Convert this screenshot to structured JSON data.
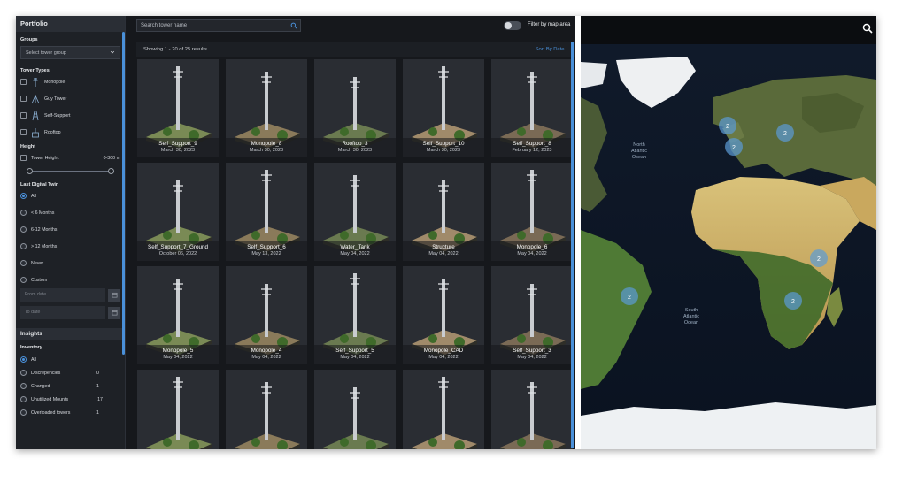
{
  "sidebar": {
    "title": "Portfolio",
    "groups_label": "Groups",
    "groups_select": "Select tower group",
    "tower_types_label": "Tower Types",
    "tower_types": [
      "Monopole",
      "Guy Tower",
      "Self-Support",
      "Rooftop"
    ],
    "height_label": "Height",
    "tower_height_label": "Tower Height:",
    "tower_height_value": "0-300 m",
    "last_twin_label": "Last Digital Twin",
    "last_twin_options": [
      "All",
      "< 6 Months",
      "6-12 Months",
      "> 12 Months",
      "Never",
      "Custom"
    ],
    "from_placeholder": "From date",
    "to_placeholder": "To date",
    "insights_label": "Insights",
    "inventory_label": "Inventory",
    "inventory": [
      {
        "label": "All",
        "count": ""
      },
      {
        "label": "Discrepencies",
        "count": "0"
      },
      {
        "label": "Changed",
        "count": "1"
      },
      {
        "label": "Unutilized Mounts",
        "count": "17"
      },
      {
        "label": "Overloaded towers",
        "count": "1"
      }
    ]
  },
  "center": {
    "search_placeholder": "Search tower name",
    "filter_label": "Filter by map area",
    "results_text": "Showing 1 - 20 of 25 results",
    "sort_label": "Sort By Date ↓",
    "cards": [
      {
        "name": "Self_Support_9",
        "date": "March 30, 2023"
      },
      {
        "name": "Monopole_8",
        "date": "March 30, 2023"
      },
      {
        "name": "Rooftop_3",
        "date": "March 30, 2023"
      },
      {
        "name": "Self_Support_10",
        "date": "March 30, 2023"
      },
      {
        "name": "Self_Support_8",
        "date": "February 12, 2023"
      },
      {
        "name": "Self_Support_7_Ground",
        "date": "October 06, 2022"
      },
      {
        "name": "Self_Support_6",
        "date": "May 13, 2022"
      },
      {
        "name": "Water_Tank",
        "date": "May 04, 2022"
      },
      {
        "name": "Structure",
        "date": "May 04, 2022"
      },
      {
        "name": "Monopole_6",
        "date": "May 04, 2022"
      },
      {
        "name": "Monopole_5",
        "date": "May 04, 2022"
      },
      {
        "name": "Monopole_4",
        "date": "May 04, 2022"
      },
      {
        "name": "Self_Support_5",
        "date": "May 04, 2022"
      },
      {
        "name": "Monopole_CAD",
        "date": "May 04, 2022"
      },
      {
        "name": "Self_Support_3",
        "date": "May 04, 2022"
      },
      {
        "name": "",
        "date": ""
      },
      {
        "name": "",
        "date": ""
      },
      {
        "name": "",
        "date": ""
      },
      {
        "name": "",
        "date": ""
      },
      {
        "name": "",
        "date": ""
      }
    ]
  },
  "map": {
    "labels": {
      "north_atlantic": [
        "North",
        "Atlantic",
        "Ocean"
      ],
      "south_atlantic": [
        "South",
        "Atlantic",
        "Ocean"
      ]
    },
    "clusters": [
      "2",
      "2",
      "2",
      "2",
      "2",
      "2"
    ]
  },
  "colors": {
    "accent": "#4a90d9",
    "cluster": "#5b9bd5"
  }
}
